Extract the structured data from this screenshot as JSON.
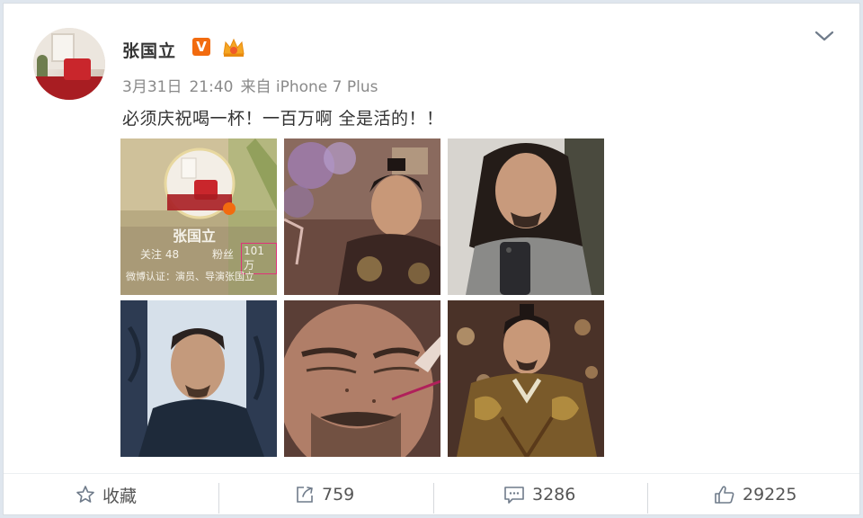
{
  "user": {
    "name": "张国立",
    "verified_badge": "V",
    "verified_color": "#f26b0f"
  },
  "post": {
    "date": "3月31日",
    "time": "21:40",
    "source": "来自 iPhone 7 Plus",
    "text": "必须庆祝喝一杯！一百万啊 全是活的！！"
  },
  "photo_1_overlay": {
    "name": "张国立",
    "follow": "关注 48",
    "fans_label": "粉丝",
    "fans_value": "101万",
    "bio": "微博认证：演员、导演张国立"
  },
  "photos": [
    {
      "icon": "profile-screenshot-photo"
    },
    {
      "icon": "costume-actor-photo"
    },
    {
      "icon": "long-hair-selfie-photo"
    },
    {
      "icon": "portrait-photo"
    },
    {
      "icon": "makeup-closeup-photo"
    },
    {
      "icon": "emperor-costume-photo"
    }
  ],
  "actions": {
    "favorite_label": "收藏",
    "repost_count": "759",
    "comment_count": "3286",
    "like_count": "29225"
  },
  "icons": {
    "favorite": "star-icon",
    "repost": "share-icon",
    "comment": "comment-icon",
    "like": "thumbs-up-icon",
    "expand": "chevron-down-icon"
  }
}
